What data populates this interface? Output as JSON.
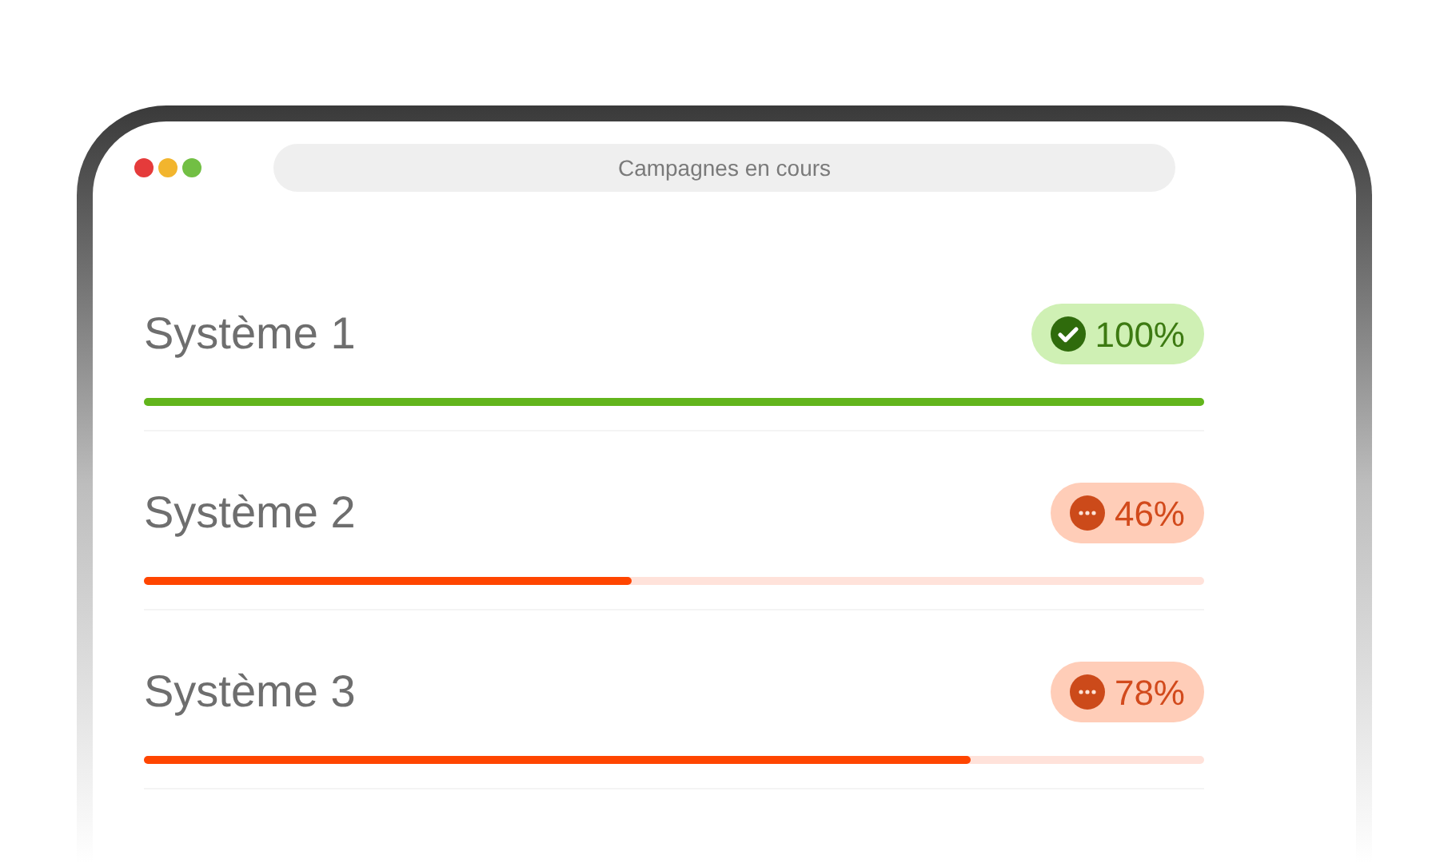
{
  "window": {
    "title": "Campagnes en cours"
  },
  "systems": [
    {
      "name": "Système 1",
      "kind": "complete",
      "reading": "100%",
      "level": 1.0
    },
    {
      "name": "Système 2",
      "kind": "progress",
      "reading": "46%",
      "level": 0.46
    },
    {
      "name": "Système 3",
      "kind": "progress",
      "reading": "78%",
      "level": 0.78
    }
  ]
}
